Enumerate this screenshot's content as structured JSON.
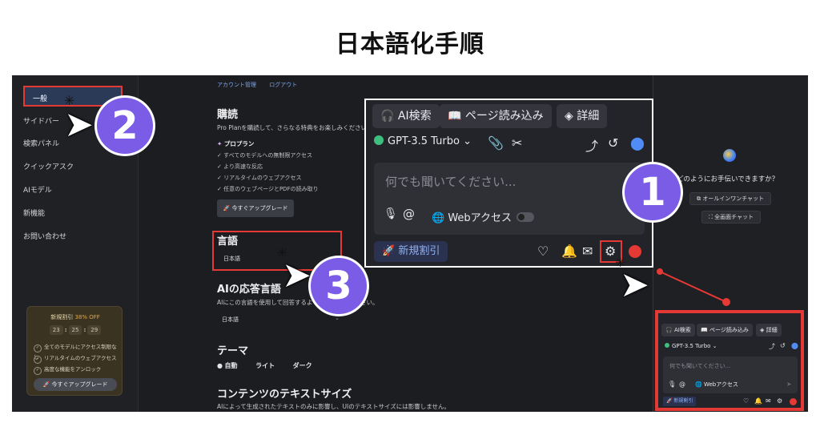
{
  "page_title": "日本語化手順",
  "sidebar": {
    "items": [
      "一般",
      "サイドバー",
      "検索パネル",
      "クイックアスク",
      "AIモデル",
      "新機能",
      "お問い合わせ"
    ],
    "promo": {
      "title": "新規割引",
      "discount": "38% OFF",
      "timer": [
        "23",
        "25",
        "29"
      ],
      "timer_sep": ":",
      "features": [
        "全てのモデルにアクセス制限なし",
        "リアルタイムのウェブアクセス",
        "高度な機能をアンロック"
      ],
      "button": "🚀 今すぐアップグレード"
    }
  },
  "main": {
    "breadcrumbs": [
      "アカウント管理",
      "ログアウト"
    ],
    "subscribe_title": "購読",
    "subscribe_desc": "Pro Planを購読して、さらなる特典をお楽しみください",
    "plan_name": "プロプラン",
    "plan_features": [
      "すべてのモデルへの無制限アクセス",
      "より高速な反応",
      "リアルタイムのウェブアクセス",
      "任意のウェブページとPDFの読み取り"
    ],
    "upgrade_button": "🚀 今すぐアップグレード",
    "language_title": "言語",
    "language_value": "日本語",
    "response_lang_title": "AIの応答言語",
    "response_lang_desc": "AIにこの言語を使用して回答するように指示してください。",
    "response_lang_value": "日本語",
    "theme_title": "テーマ",
    "theme_options": [
      "自動",
      "ライト",
      "ダーク"
    ],
    "text_size_title": "コンテンツのテキストサイズ",
    "text_size_desc": "AIによって生成されたテキストのみに影響し、UIのテキストサイズには影響しません。"
  },
  "right_panel": {
    "question": "どのようにお手伝いできますか？",
    "buttons": [
      "オールインワンチャット",
      "全画面チャット"
    ]
  },
  "popup": {
    "tabs": [
      "AI検索",
      "ページ読み込み",
      "詳細"
    ],
    "model": "GPT-3.5 Turbo",
    "placeholder": "何でも聞いてください...",
    "web_access": "Webアクセス",
    "promo": "新規割引"
  },
  "steps": [
    "1",
    "2",
    "3"
  ],
  "colors": {
    "highlight": "#e53935",
    "step": "#7b5ce6",
    "accent": "#2b3a57"
  }
}
